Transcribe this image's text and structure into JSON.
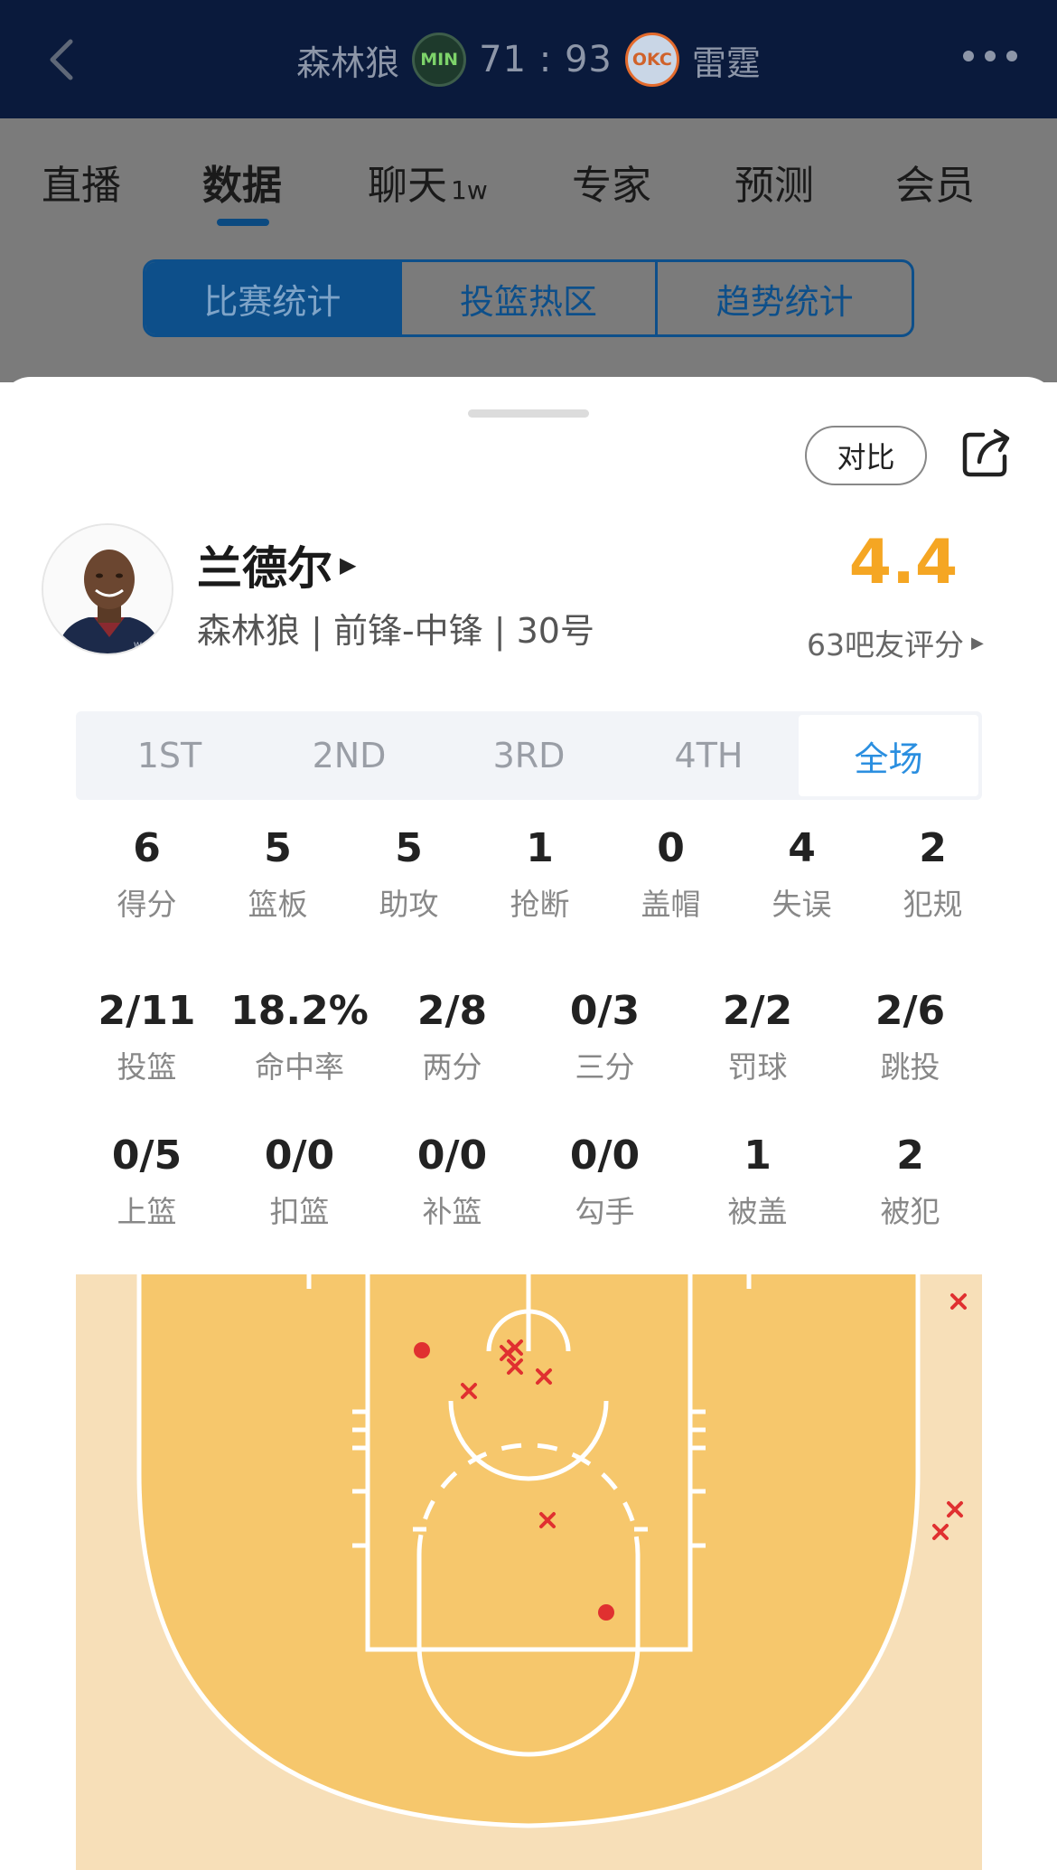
{
  "header": {
    "home_team": "森林狼",
    "home_abbr": "MIN",
    "score": "71 : 93",
    "away_abbr": "OKC",
    "away_team": "雷霆"
  },
  "tabs": [
    {
      "label": "直播"
    },
    {
      "label": "数据",
      "active": true
    },
    {
      "label": "聊天",
      "badge": "1w"
    },
    {
      "label": "专家"
    },
    {
      "label": "预测"
    },
    {
      "label": "会员"
    }
  ],
  "segments": [
    "比赛统计",
    "投篮热区",
    "趋势统计"
  ],
  "sheet": {
    "compare_label": "对比",
    "player": {
      "name": "兰德尔",
      "meta": "森林狼 | 前锋-中锋 | 30号",
      "rating": "4.4",
      "rating_caption": "63吧友评分"
    },
    "quarters": [
      "1ST",
      "2ND",
      "3RD",
      "4TH",
      "全场"
    ],
    "active_quarter": "全场",
    "stats_basic": [
      {
        "value": "6",
        "label": "得分"
      },
      {
        "value": "5",
        "label": "篮板"
      },
      {
        "value": "5",
        "label": "助攻"
      },
      {
        "value": "1",
        "label": "抢断"
      },
      {
        "value": "0",
        "label": "盖帽"
      },
      {
        "value": "4",
        "label": "失误"
      },
      {
        "value": "2",
        "label": "犯规"
      }
    ],
    "stats_shooting": [
      {
        "value": "2/11",
        "label": "投篮"
      },
      {
        "value": "18.2%",
        "label": "命中率"
      },
      {
        "value": "2/8",
        "label": "两分"
      },
      {
        "value": "0/3",
        "label": "三分"
      },
      {
        "value": "2/2",
        "label": "罚球"
      },
      {
        "value": "2/6",
        "label": "跳投"
      }
    ],
    "stats_detail": [
      {
        "value": "0/5",
        "label": "上篮"
      },
      {
        "value": "0/0",
        "label": "扣篮"
      },
      {
        "value": "0/0",
        "label": "补篮"
      },
      {
        "value": "0/0",
        "label": "勾手"
      },
      {
        "value": "1",
        "label": "被盖"
      },
      {
        "value": "2",
        "label": "被犯"
      }
    ]
  },
  "colors": {
    "rating": "#f5a623",
    "active_tab": "#2b8fe0",
    "made_shot": "#e03030",
    "missed_shot": "#e03030",
    "court_inner": "#f6c76c",
    "court_outer": "#f7dfb8"
  },
  "icons": {
    "back": "chevron-left-icon",
    "more": "more-dots-icon",
    "share": "share-icon"
  }
}
